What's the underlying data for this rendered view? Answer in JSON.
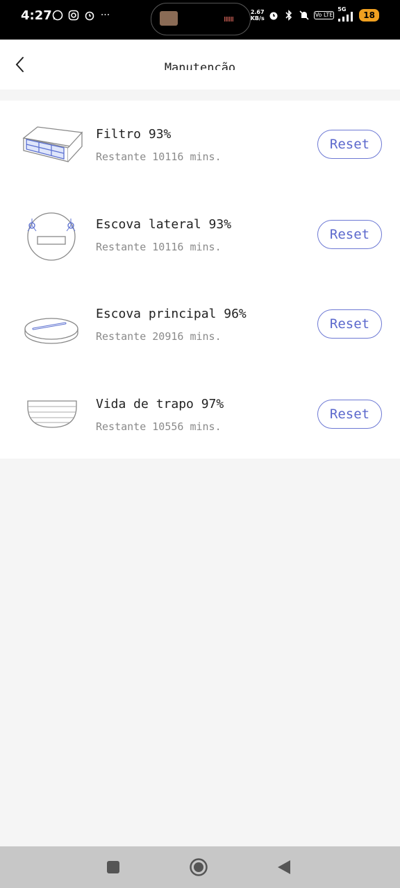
{
  "status_bar": {
    "time": "4:27",
    "network_speed_value": "2.67",
    "network_speed_unit": "KB/s",
    "network_type": "5G",
    "volte": "Vo LTE",
    "battery": "18",
    "icons": [
      "whatsapp-icon",
      "instagram-icon",
      "alarm-icon",
      "more-icon",
      "alarm-icon",
      "bluetooth-icon",
      "mute-icon",
      "signal-icon"
    ]
  },
  "header": {
    "title": "Manutenção",
    "back_icon": "chevron-left-icon"
  },
  "items": [
    {
      "title": "Filtro 93%",
      "subtitle": "Restante 10116 mins.",
      "button": "Reset",
      "icon": "filter-icon"
    },
    {
      "title": "Escova lateral 93%",
      "subtitle": "Restante 10116 mins.",
      "button": "Reset",
      "icon": "side-brush-icon"
    },
    {
      "title": "Escova principal 96%",
      "subtitle": "Restante 20916 mins.",
      "button": "Reset",
      "icon": "main-brush-icon"
    },
    {
      "title": "Vida de trapo 97%",
      "subtitle": "Restante 10556 mins.",
      "button": "Reset",
      "icon": "mop-icon"
    }
  ],
  "colors": {
    "accent": "#5a67cc",
    "background": "#f5f5f5",
    "card": "#ffffff",
    "secondary_text": "#8a8a8a"
  }
}
